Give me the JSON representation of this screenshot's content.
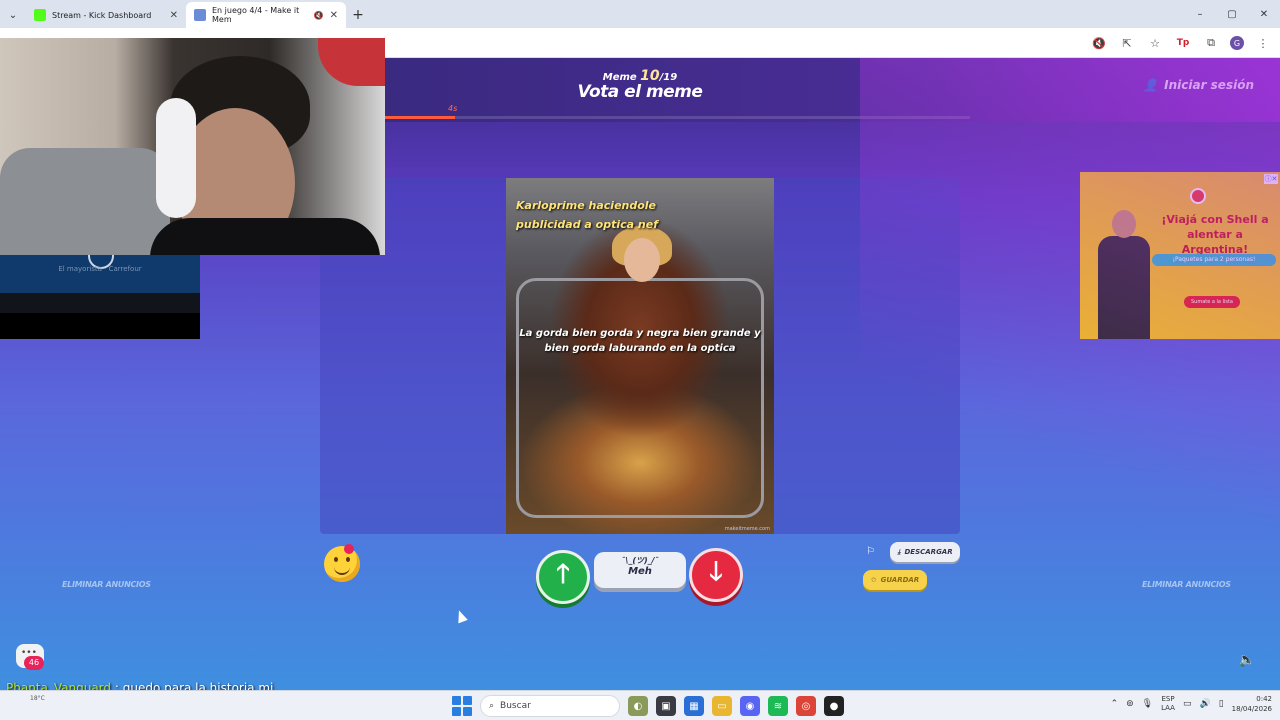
{
  "browser": {
    "tabs": [
      {
        "title": "Stream - Kick Dashboard",
        "active": false,
        "favicon_color": "#53fc18"
      },
      {
        "title": "En juego 4/4 - Make it Mem",
        "active": true,
        "favicon_color": "#6b8bd6"
      }
    ],
    "new_tab": "+",
    "window_controls": {
      "minimize": "–",
      "maximize": "▢",
      "close": "✕"
    },
    "extension_icons": {
      "profile_initial": "G",
      "tp": "Tp"
    }
  },
  "game": {
    "meme_label": "Meme",
    "meme_current": "10",
    "meme_total": "/19",
    "title": "Vota el meme",
    "login_label": "Iniciar sesión",
    "timer_label": "4s",
    "timer_progress": 0.12
  },
  "meme": {
    "caption_top": "Karloprime haciendole publicidad a optica nef",
    "caption_middle": "La gorda bien gorda y negra bien grande y bien gorda laburando en la optica",
    "watermark": "makeitmeme.com"
  },
  "voting": {
    "meh_shrug": "¯\\_(ツ)_/¯",
    "meh_label": "Meh",
    "up_symbol": "🡑",
    "down_symbol": "🡓",
    "download_label": "DESCARGAR",
    "save_label": "GUARDAR"
  },
  "ads": {
    "remove_ads_label": "ELIMINAR ANUNCIOS",
    "headline": "¡Viajá con Shell a alentar a Argentina!",
    "pill": "¡Paquetes para 2 personas!",
    "cta": "Sumate a la lista",
    "close": "ⓘ✕"
  },
  "stream_overlay": {
    "small_text": "El mayorista · Carrefour",
    "chat_count": "46",
    "chat_user": "Phanta_Vanguard",
    "chat_sep": ":",
    "chat_text": "quedo para la historia mi meme del pelado"
  },
  "taskbar": {
    "weather": "18°C",
    "search_placeholder": "Buscar",
    "lang_top": "ESP",
    "lang_bottom": "LAA",
    "time": "0:42",
    "date": "18/04/2026"
  }
}
